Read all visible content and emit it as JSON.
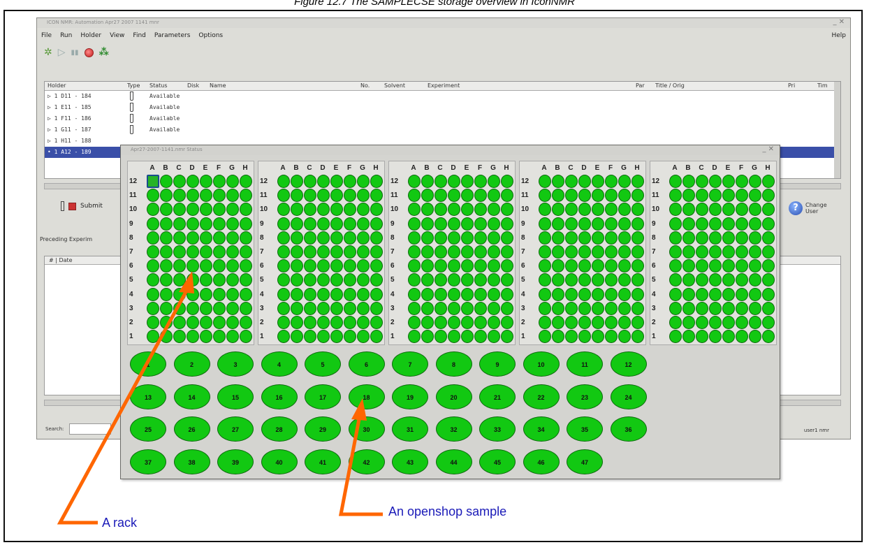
{
  "caption": "Figure 12.7 The SAMPLECSE storage overview in IconNMR",
  "main_window": {
    "title": "ICON NMR: Automation Apr27 2007 1141 mnr",
    "controls": "_ ✕",
    "menu": [
      "File",
      "Run",
      "Holder",
      "View",
      "Find",
      "Parameters",
      "Options"
    ],
    "help": "Help",
    "columns": [
      "Holder",
      "Type",
      "Status",
      "Disk",
      "Name",
      "No.",
      "Solvent",
      "Experiment",
      "Par",
      "Title / Orig",
      "Pri",
      "Tim"
    ],
    "rows": [
      {
        "holder": "▷ 1  D11 - 184",
        "status": "Available"
      },
      {
        "holder": "▷ 1  E11 - 185",
        "status": "Available"
      },
      {
        "holder": "▷ 1  F11 - 186",
        "status": "Available"
      },
      {
        "holder": "▷ 1  G11 - 187",
        "status": "Available"
      },
      {
        "holder": "▷ 1  H11 - 188",
        "status": ""
      },
      {
        "holder": "• 1  A12 - 189",
        "status": ""
      }
    ],
    "submit_label": "Submit",
    "change_user_label": "Change User",
    "change_user_icon": "?",
    "preceding_label": "Preceding Experim",
    "lower_header": "# | Date",
    "search_label": "Search:",
    "status_right": "user1  nmr"
  },
  "status_window": {
    "title": "Apr27-2007-1141.nmr Status",
    "controls": "_ ✕",
    "columns": [
      "A",
      "B",
      "C",
      "D",
      "E",
      "F",
      "G",
      "H"
    ],
    "rows": [
      12,
      11,
      10,
      9,
      8,
      7,
      6,
      5,
      4,
      3,
      2,
      1
    ],
    "rack_count": 5,
    "selected_well": {
      "rack": 1,
      "row": 12,
      "col": "A"
    },
    "openshop_positions": [
      "1",
      "2",
      "3",
      "4",
      "5",
      "6",
      "7",
      "8",
      "9",
      "10",
      "11",
      "12",
      "13",
      "14",
      "15",
      "16",
      "17",
      "18",
      "19",
      "20",
      "21",
      "22",
      "23",
      "24",
      "25",
      "26",
      "27",
      "28",
      "29",
      "30",
      "31",
      "32",
      "33",
      "34",
      "35",
      "36",
      "37",
      "38",
      "39",
      "40",
      "41",
      "42",
      "43",
      "44",
      "45",
      "46",
      "47"
    ]
  },
  "annotations": {
    "rack": "A rack",
    "openshop": "An openshop sample",
    "arrow_color": "#ff6600"
  },
  "colors": {
    "well_green": "#12c812",
    "selection_blue": "#3a4fa8"
  }
}
